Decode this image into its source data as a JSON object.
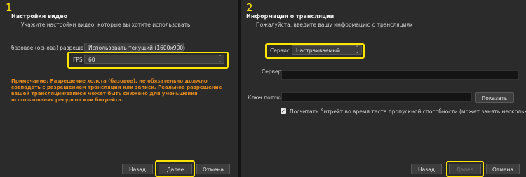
{
  "left": {
    "step": "1",
    "title": "Настройки видео",
    "subtitle": "Укажите настройки видео, которые вы хотите использовать",
    "base_res_label": "базовое (основа) разрешение",
    "base_res_value": "Использовать текущий (1600x900)",
    "fps_label": "FPS",
    "fps_value": "60",
    "note_lines": [
      "Примечание: Разрешение холста (базовое), не обязательно должно",
      "совпадать с разрешением трансляции или записи. Реальное разрешение",
      "вашей трансляции/записи может быть снижено для уменьшения",
      "использования ресурсов или битрейта."
    ],
    "back_label": "Назад",
    "next_label": "Далее",
    "cancel_label": "Отмена"
  },
  "right": {
    "step": "2",
    "title": "Информация о трансляции",
    "subtitle": "Пожалуйста, введите вашу информацию о трансляциях",
    "service_label": "Сервис",
    "service_value": "Настраиваемый...",
    "server_label": "Сервер",
    "server_value": "",
    "key_label": "Ключ потока",
    "key_value": "",
    "show_label": "Показать",
    "checkbox_label": "Посчитать битрейт во время теста пропускной способности (может занять несколько минут)",
    "checkbox_checked": true,
    "back_label": "Назад",
    "next_label": "Далее",
    "cancel_label": "Отмена"
  },
  "colors": {
    "highlight": "#ffe400",
    "note": "#e08a1e",
    "panel_bg": "#2b2b2b"
  }
}
